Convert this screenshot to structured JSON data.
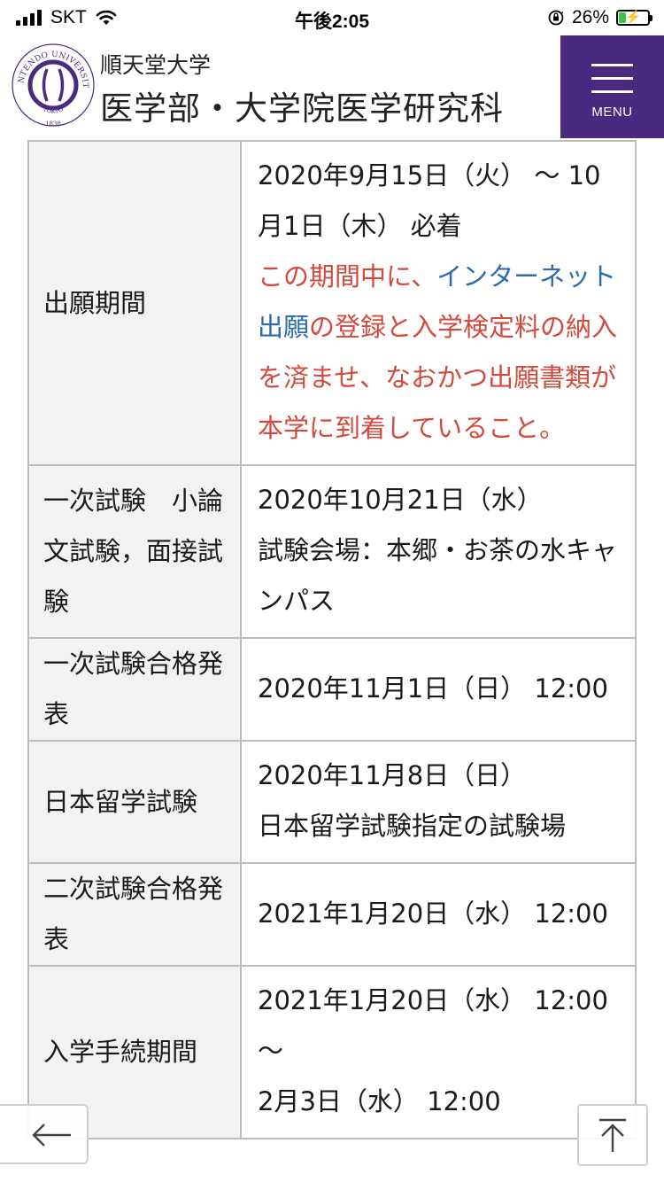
{
  "status_bar": {
    "carrier": "SKT",
    "time": "午後2:05",
    "battery_percent": "26%",
    "battery_level": 0.26,
    "battery_color": "#3cc34a"
  },
  "header": {
    "logo_icon": "juntendo-university-seal-icon",
    "logo_text": "JUNTENDO UNIVERSITY TOKYO 1838",
    "school_name": "順天堂大学",
    "department": "医学部・大学院医学研究科",
    "menu_label": "MENU",
    "menu_color": "#4a2a7e"
  },
  "schedule": {
    "rows": [
      {
        "label": "出願期間",
        "value_parts": [
          {
            "text": "2020年9月15日（火） 〜 10月1日（木） 必着",
            "style": "normal"
          },
          {
            "text": "この期間中に、",
            "style": "red"
          },
          {
            "text": "インターネット出願",
            "style": "blue"
          },
          {
            "text": "の登録と入学検定料の納入を済ませ、なおかつ出願書類が本学に到着していること。",
            "style": "red"
          }
        ]
      },
      {
        "label": "一次試験　小論文試験，面接試験",
        "value_lines": [
          "2020年10月21日（水）",
          "試験会場：本郷・お茶の水キャンパス"
        ]
      },
      {
        "label": "一次試験合格発表",
        "value_lines": [
          "2020年11月1日（日） 12:00"
        ]
      },
      {
        "label": "日本留学試験",
        "value_lines": [
          "2020年11月8日（日）",
          "日本留学試験指定の試験場"
        ]
      },
      {
        "label": "二次試験合格発表",
        "value_lines": [
          "2021年1月20日（水） 12:00"
        ]
      },
      {
        "label": "入学手続期間",
        "value_lines": [
          "2021年1月20日（水） 12:00 〜",
          "2月3日（水） 12:00"
        ]
      }
    ]
  },
  "floating": {
    "back_icon": "arrow-left-icon",
    "top_icon": "arrow-up-to-top-icon"
  },
  "colors": {
    "notice_red": "#d24a3c",
    "link_blue": "#2b6ab0",
    "label_bg": "#f2f2f2",
    "border": "#bdbdbd"
  }
}
